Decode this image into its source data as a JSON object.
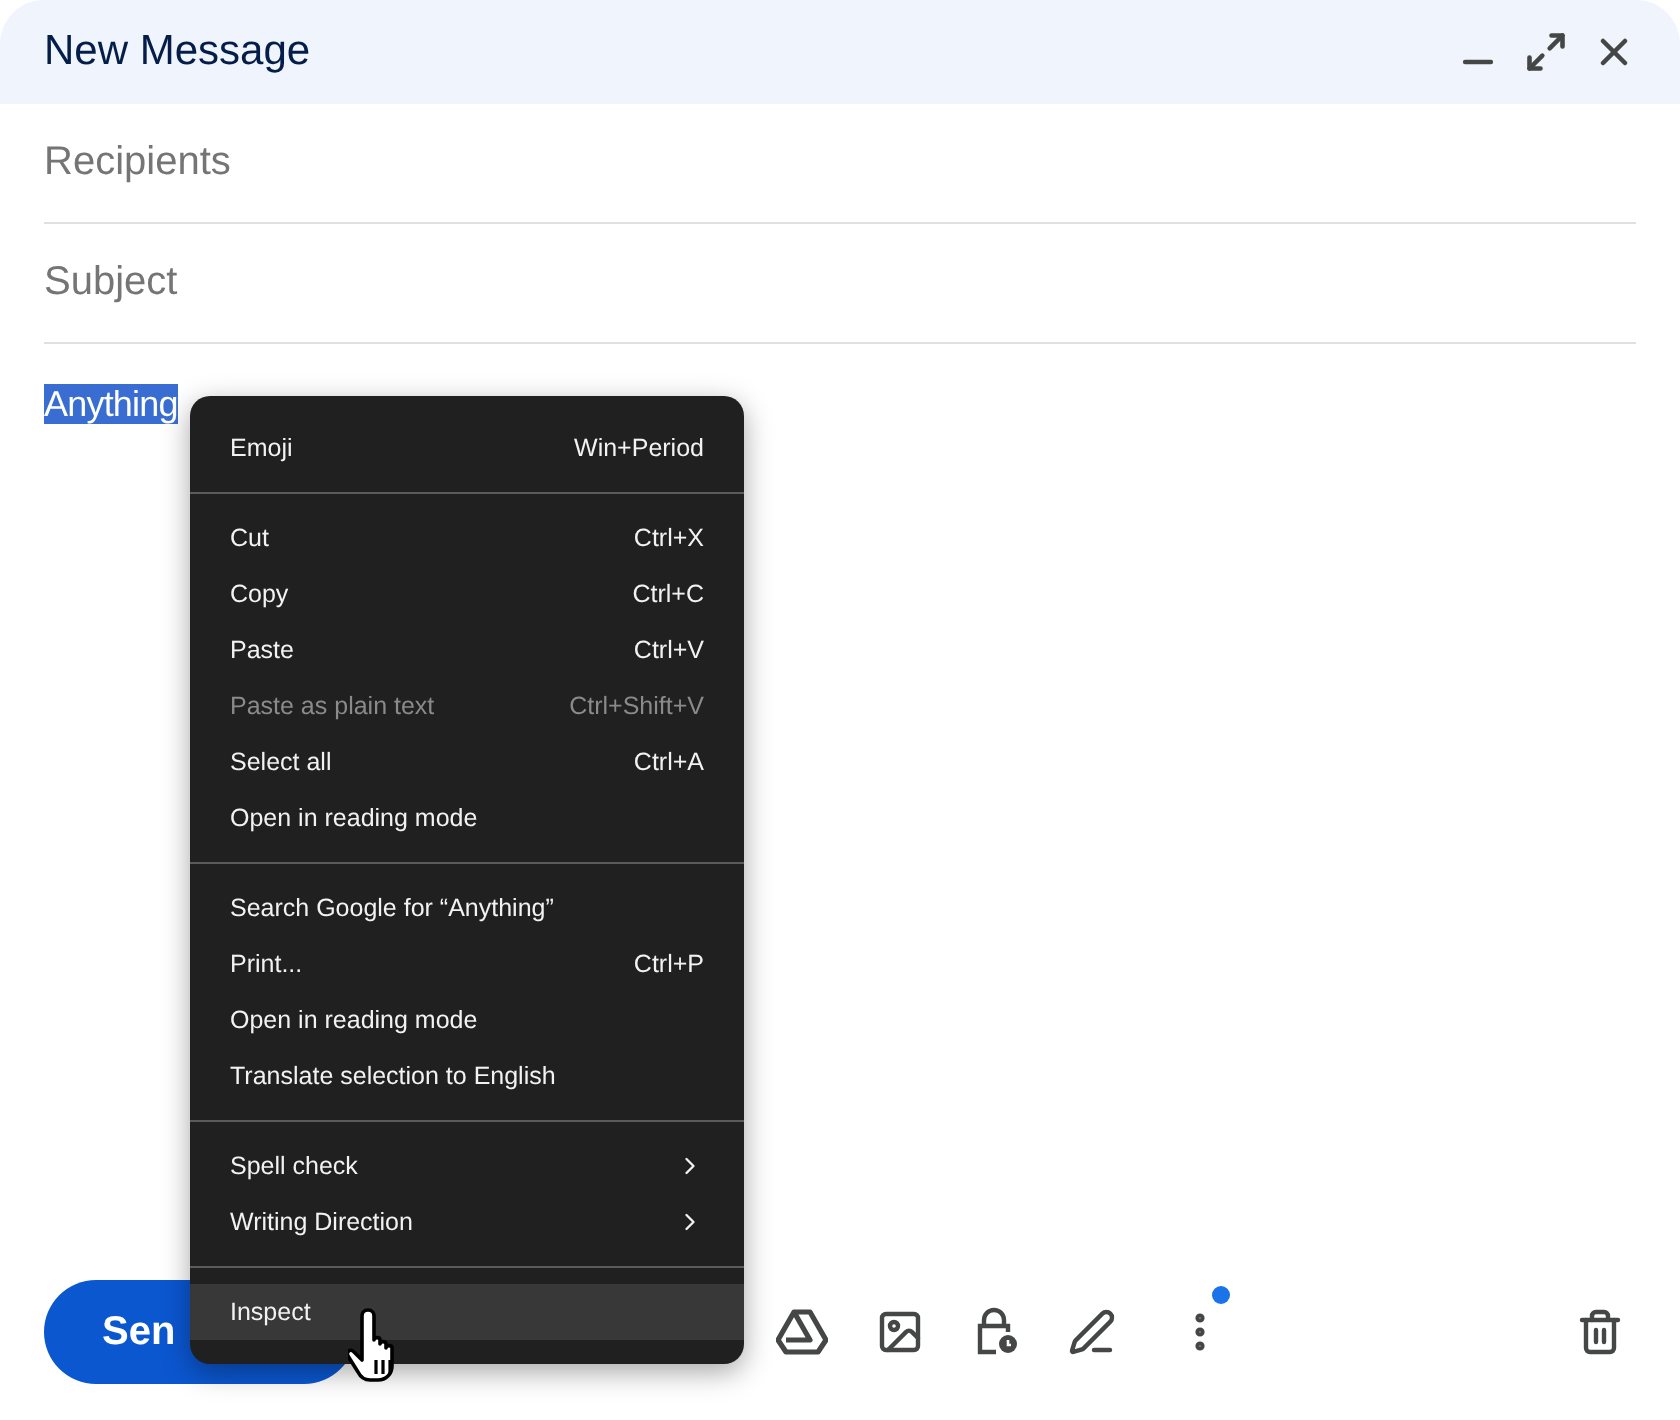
{
  "window": {
    "title": "New Message"
  },
  "fields": [
    {
      "placeholder": "Recipients"
    },
    {
      "placeholder": "Subject"
    }
  ],
  "body": {
    "text": "Anything",
    "selected": true
  },
  "send_button": {
    "label": "Sen"
  },
  "toolbar": {
    "more_badge": true
  },
  "context_menu": {
    "sections": [
      [
        {
          "label": "Emoji",
          "shortcut": "Win+Period",
          "disabled": false,
          "submenu": false,
          "highlighted": false
        }
      ],
      [
        {
          "label": "Cut",
          "shortcut": "Ctrl+X",
          "disabled": false,
          "submenu": false,
          "highlighted": false
        },
        {
          "label": "Copy",
          "shortcut": "Ctrl+C",
          "disabled": false,
          "submenu": false,
          "highlighted": false
        },
        {
          "label": "Paste",
          "shortcut": "Ctrl+V",
          "disabled": false,
          "submenu": false,
          "highlighted": false
        },
        {
          "label": "Paste as plain text",
          "shortcut": "Ctrl+Shift+V",
          "disabled": true,
          "submenu": false,
          "highlighted": false
        },
        {
          "label": "Select all",
          "shortcut": "Ctrl+A",
          "disabled": false,
          "submenu": false,
          "highlighted": false
        },
        {
          "label": "Open in reading mode",
          "disabled": false,
          "submenu": false,
          "highlighted": false
        }
      ],
      [
        {
          "label": "Search Google for “Anything”",
          "disabled": false,
          "submenu": false,
          "highlighted": false
        },
        {
          "label": "Print...",
          "shortcut": "Ctrl+P",
          "disabled": false,
          "submenu": false,
          "highlighted": false
        },
        {
          "label": "Open in reading mode",
          "disabled": false,
          "submenu": false,
          "highlighted": false
        },
        {
          "label": "Translate selection to English",
          "disabled": false,
          "submenu": false,
          "highlighted": false
        }
      ],
      [
        {
          "label": "Spell check",
          "disabled": false,
          "submenu": true,
          "highlighted": false
        },
        {
          "label": "Writing Direction",
          "disabled": false,
          "submenu": true,
          "highlighted": false
        }
      ],
      [
        {
          "label": "Inspect",
          "disabled": false,
          "submenu": false,
          "highlighted": true
        }
      ]
    ]
  }
}
